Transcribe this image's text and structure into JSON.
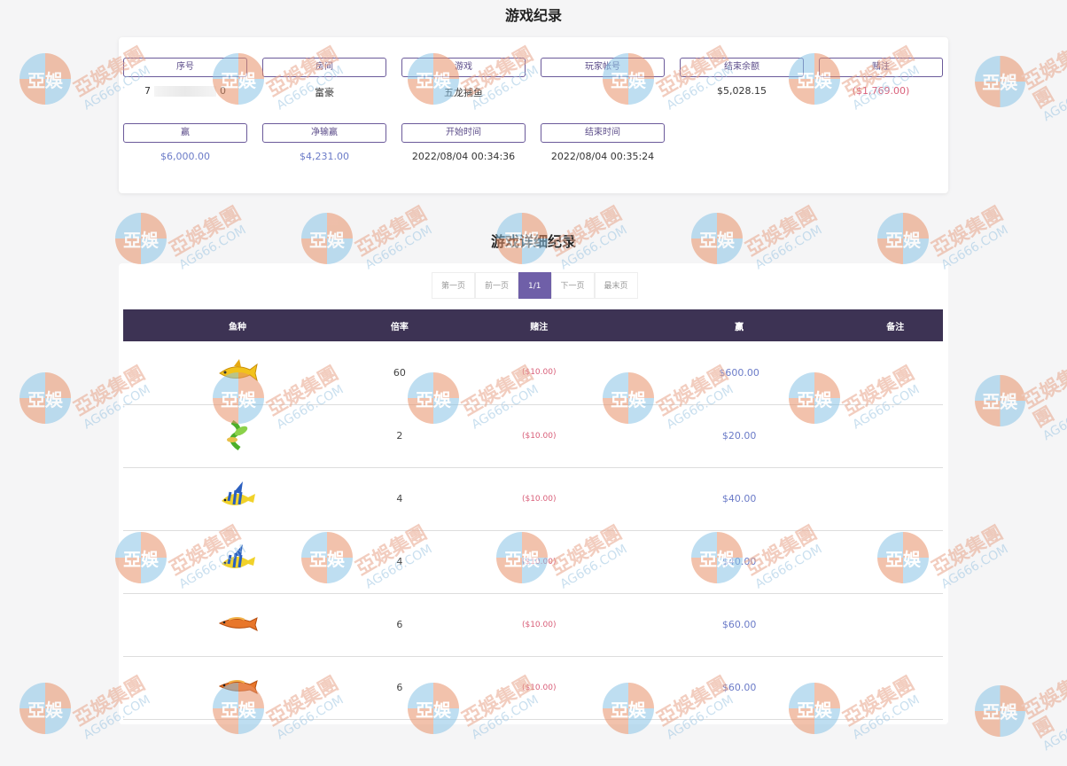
{
  "page_title": "游戏纪录",
  "summary": {
    "fields": [
      {
        "label": "序号",
        "value": "7",
        "value_suffix": "0",
        "masked": true
      },
      {
        "label": "房间",
        "value": "富豪"
      },
      {
        "label": "游戏",
        "value": "五龙捕鱼"
      },
      {
        "label": "玩家帐号",
        "value": ""
      },
      {
        "label": "结束余额",
        "value": "$5,028.15"
      },
      {
        "label": "赌注",
        "value": "($1,769.00)"
      },
      {
        "label": "赢",
        "value": "$6,000.00"
      },
      {
        "label": "净输赢",
        "value": "$4,231.00"
      },
      {
        "label": "开始时间",
        "value": "2022/08/04 00:34:36"
      },
      {
        "label": "结束时间",
        "value": "2022/08/04 00:35:24"
      }
    ]
  },
  "detail_title": "游戏详细纪录",
  "pager": {
    "first": "第一页",
    "prev": "前一页",
    "current": "1/1",
    "next": "下一页",
    "last": "最末页"
  },
  "table": {
    "headers": [
      "鱼种",
      "倍率",
      "赌注",
      "赢",
      "备注"
    ],
    "rows": [
      {
        "fish": "golden-shark-icon",
        "rate": "60",
        "bet": "($10.00)",
        "win": "$600.00",
        "note": ""
      },
      {
        "fish": "green-dragonfly-fish-icon",
        "rate": "2",
        "bet": "($10.00)",
        "win": "$20.00",
        "note": ""
      },
      {
        "fish": "angelfish-icon",
        "rate": "4",
        "bet": "($10.00)",
        "win": "$40.00",
        "note": ""
      },
      {
        "fish": "angelfish-icon",
        "rate": "4",
        "bet": "($10.00)",
        "win": "$40.00",
        "note": ""
      },
      {
        "fish": "orange-arowana-icon",
        "rate": "6",
        "bet": "($10.00)",
        "win": "$60.00",
        "note": ""
      },
      {
        "fish": "orange-arowana-icon",
        "rate": "6",
        "bet": "($10.00)",
        "win": "$60.00",
        "note": ""
      }
    ]
  },
  "watermark": {
    "badge": "亞娛",
    "brand": "亞娛集團",
    "domain": "AG666.COM"
  },
  "colors": {
    "accent": "#6f5fa8",
    "header_bg": "#3d3354",
    "negative": "#d9607a",
    "positive": "#6b7bc8"
  }
}
